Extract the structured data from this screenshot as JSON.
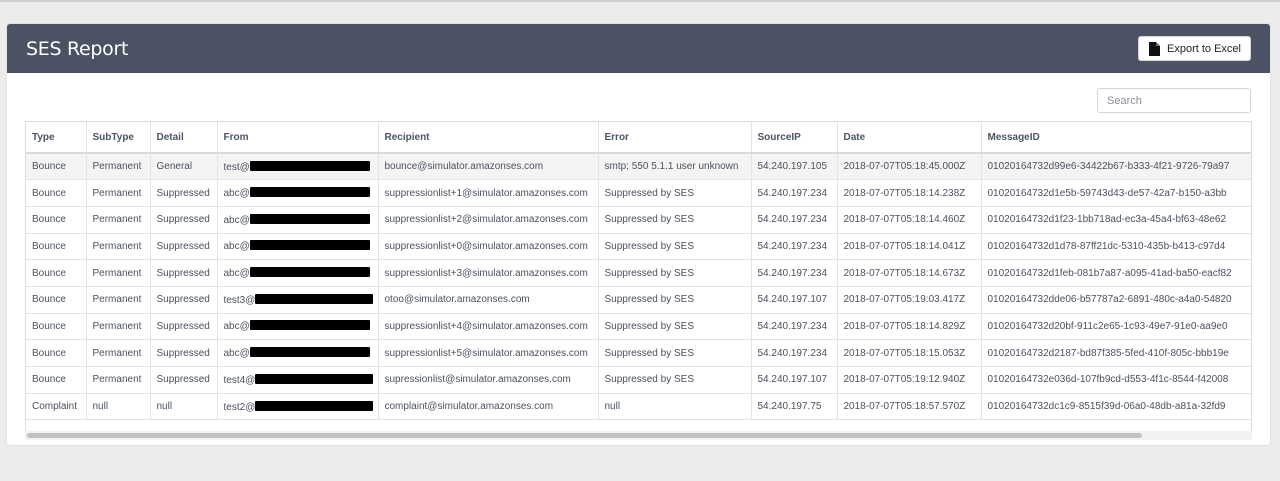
{
  "page": {
    "title": "SES Report",
    "export_label": "Export to Excel",
    "search_placeholder": "Search"
  },
  "table": {
    "columns": [
      "Type",
      "SubType",
      "Detail",
      "From",
      "Recipient",
      "Error",
      "SourceIP",
      "Date",
      "MessageID"
    ],
    "rows": [
      {
        "type": "Bounce",
        "subtype": "Permanent",
        "detail": "General",
        "from": "test@",
        "recipient": "bounce@simulator.amazonses.com",
        "error": "smtp; 550 5.1.1 user unknown",
        "source_ip": "54.240.197.105",
        "date": "2018-07-07T05:18:45.000Z",
        "message_id": "01020164732d99e6-34422b67-b333-4f21-9726-79a97"
      },
      {
        "type": "Bounce",
        "subtype": "Permanent",
        "detail": "Suppressed",
        "from": "abc@",
        "recipient": "suppressionlist+1@simulator.amazonses.com",
        "error": "Suppressed by SES",
        "source_ip": "54.240.197.234",
        "date": "2018-07-07T05:18:14.238Z",
        "message_id": "01020164732d1e5b-59743d43-de57-42a7-b150-a3bb"
      },
      {
        "type": "Bounce",
        "subtype": "Permanent",
        "detail": "Suppressed",
        "from": "abc@",
        "recipient": "suppressionlist+2@simulator.amazonses.com",
        "error": "Suppressed by SES",
        "source_ip": "54.240.197.234",
        "date": "2018-07-07T05:18:14.460Z",
        "message_id": "01020164732d1f23-1bb718ad-ec3a-45a4-bf63-48e62"
      },
      {
        "type": "Bounce",
        "subtype": "Permanent",
        "detail": "Suppressed",
        "from": "abc@",
        "recipient": "suppressionlist+0@simulator.amazonses.com",
        "error": "Suppressed by SES",
        "source_ip": "54.240.197.234",
        "date": "2018-07-07T05:18:14.041Z",
        "message_id": "01020164732d1d78-87ff21dc-5310-435b-b413-c97d4"
      },
      {
        "type": "Bounce",
        "subtype": "Permanent",
        "detail": "Suppressed",
        "from": "abc@",
        "recipient": "suppressionlist+3@simulator.amazonses.com",
        "error": "Suppressed by SES",
        "source_ip": "54.240.197.234",
        "date": "2018-07-07T05:18:14.673Z",
        "message_id": "01020164732d1feb-081b7a87-a095-41ad-ba50-eacf82"
      },
      {
        "type": "Bounce",
        "subtype": "Permanent",
        "detail": "Suppressed",
        "from": "test3@",
        "recipient": "otoo@simulator.amazonses.com",
        "error": "Suppressed by SES",
        "source_ip": "54.240.197.107",
        "date": "2018-07-07T05:19:03.417Z",
        "message_id": "01020164732dde06-b57787a2-6891-480c-a4a0-54820"
      },
      {
        "type": "Bounce",
        "subtype": "Permanent",
        "detail": "Suppressed",
        "from": "abc@",
        "recipient": "suppressionlist+4@simulator.amazonses.com",
        "error": "Suppressed by SES",
        "source_ip": "54.240.197.234",
        "date": "2018-07-07T05:18:14.829Z",
        "message_id": "01020164732d20bf-911c2e65-1c93-49e7-91e0-aa9e0"
      },
      {
        "type": "Bounce",
        "subtype": "Permanent",
        "detail": "Suppressed",
        "from": "abc@",
        "recipient": "suppressionlist+5@simulator.amazonses.com",
        "error": "Suppressed by SES",
        "source_ip": "54.240.197.234",
        "date": "2018-07-07T05:18:15.053Z",
        "message_id": "01020164732d2187-bd87f385-5fed-410f-805c-bbb19e"
      },
      {
        "type": "Bounce",
        "subtype": "Permanent",
        "detail": "Suppressed",
        "from": "test4@",
        "recipient": "supressionlist@simulator.amazonses.com",
        "error": "Suppressed by SES",
        "source_ip": "54.240.197.107",
        "date": "2018-07-07T05:19:12.940Z",
        "message_id": "01020164732e036d-107fb9cd-d553-4f1c-8544-f42008"
      },
      {
        "type": "Complaint",
        "subtype": "null",
        "detail": "null",
        "from": "test2@",
        "recipient": "complaint@simulator.amazonses.com",
        "error": "null",
        "source_ip": "54.240.197.75",
        "date": "2018-07-07T05:18:57.570Z",
        "message_id": "01020164732dc1c9-8515f39d-06a0-48db-a81a-32fd9"
      }
    ]
  },
  "colors": {
    "header_bg": "#4b5263",
    "page_bg": "#ececec",
    "redaction": "#000000"
  },
  "icons": {
    "export": "document-icon"
  }
}
